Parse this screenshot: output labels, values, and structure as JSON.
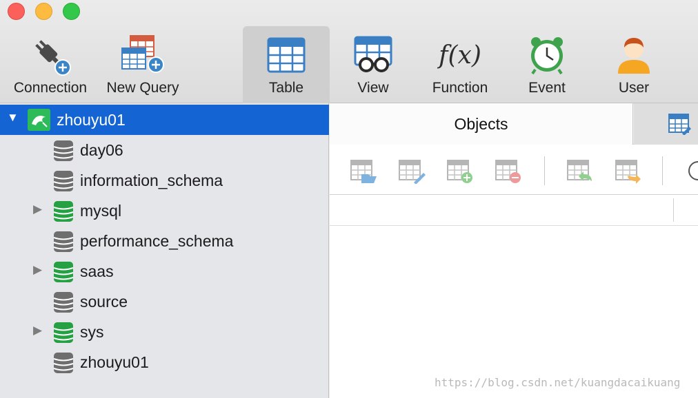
{
  "toolbar": {
    "connection_label": "Connection",
    "new_query_label": "New Query",
    "table_label": "Table",
    "view_label": "View",
    "function_label": "Function",
    "function_glyph": "f(x)",
    "event_label": "Event",
    "user_label": "User"
  },
  "tree": {
    "connection": "zhouyu01",
    "databases": [
      {
        "name": "day06",
        "expandable": false,
        "active": false
      },
      {
        "name": "information_schema",
        "expandable": false,
        "active": false
      },
      {
        "name": "mysql",
        "expandable": true,
        "active": true
      },
      {
        "name": "performance_schema",
        "expandable": false,
        "active": false
      },
      {
        "name": "saas",
        "expandable": true,
        "active": true
      },
      {
        "name": "source",
        "expandable": false,
        "active": false
      },
      {
        "name": "sys",
        "expandable": true,
        "active": true
      },
      {
        "name": "zhouyu01",
        "expandable": false,
        "active": false
      }
    ]
  },
  "main": {
    "tab_objects": "Objects"
  },
  "watermark": "https://blog.csdn.net/kuangdacaikuang",
  "colors": {
    "selection": "#1464d3",
    "db_active": "#25a043",
    "db_inactive": "#6e6e6e"
  }
}
